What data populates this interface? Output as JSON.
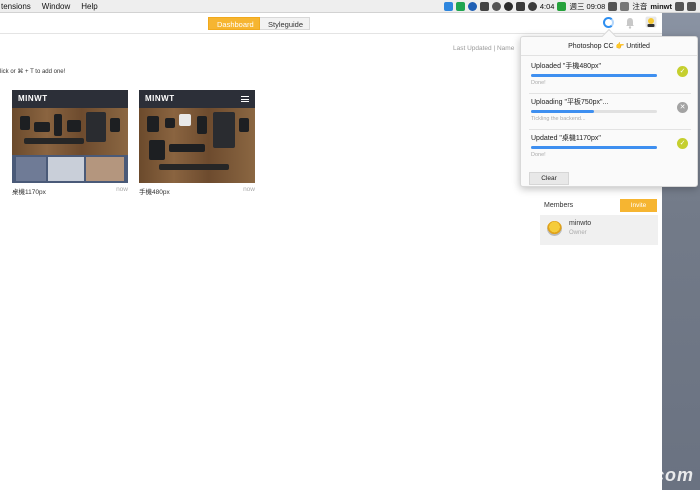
{
  "menubar": {
    "menus": [
      "tensions",
      "Window",
      "Help"
    ],
    "time": "4:04",
    "day": "週三 09:08",
    "input_method": "注音",
    "user": "minwt"
  },
  "toolbar": {
    "tabs": [
      {
        "label": "Dashboard",
        "active": true
      },
      {
        "label": "Styleguide",
        "active": false
      }
    ],
    "icons": [
      "sync-icon",
      "bell-icon",
      "user-icon"
    ]
  },
  "main": {
    "hint": "lick or ⌘ + T to add one!",
    "sort_label": "Last Updated | Name"
  },
  "cards": [
    {
      "logo": "MINWT",
      "name": "桌機1170px",
      "time": "now"
    },
    {
      "logo": "MINWT",
      "name": "手機480px",
      "time": "now"
    }
  ],
  "members": {
    "title": "Members",
    "invite_label": "Invite",
    "list": [
      {
        "name": "minwto",
        "role": "Owner"
      }
    ]
  },
  "popover": {
    "header": "Photoshop CC 👉 Untitled",
    "uploads": [
      {
        "title": "Uploaded \"手機480px\"",
        "status": "Done!",
        "progress": 1.0,
        "state": "done"
      },
      {
        "title": "Uploading \"平板750px\"...",
        "status": "Tickling the backend...",
        "progress": 0.5,
        "state": "uploading"
      },
      {
        "title": "Updated \"桌機1170px\"",
        "status": "Done!",
        "progress": 1.0,
        "state": "done"
      }
    ],
    "clear_label": "Clear"
  },
  "watermark": "minwt.com",
  "colors": {
    "accent": "#f6b531",
    "progress": "#3e8ff0",
    "done_badge": "#c5cf2e"
  }
}
